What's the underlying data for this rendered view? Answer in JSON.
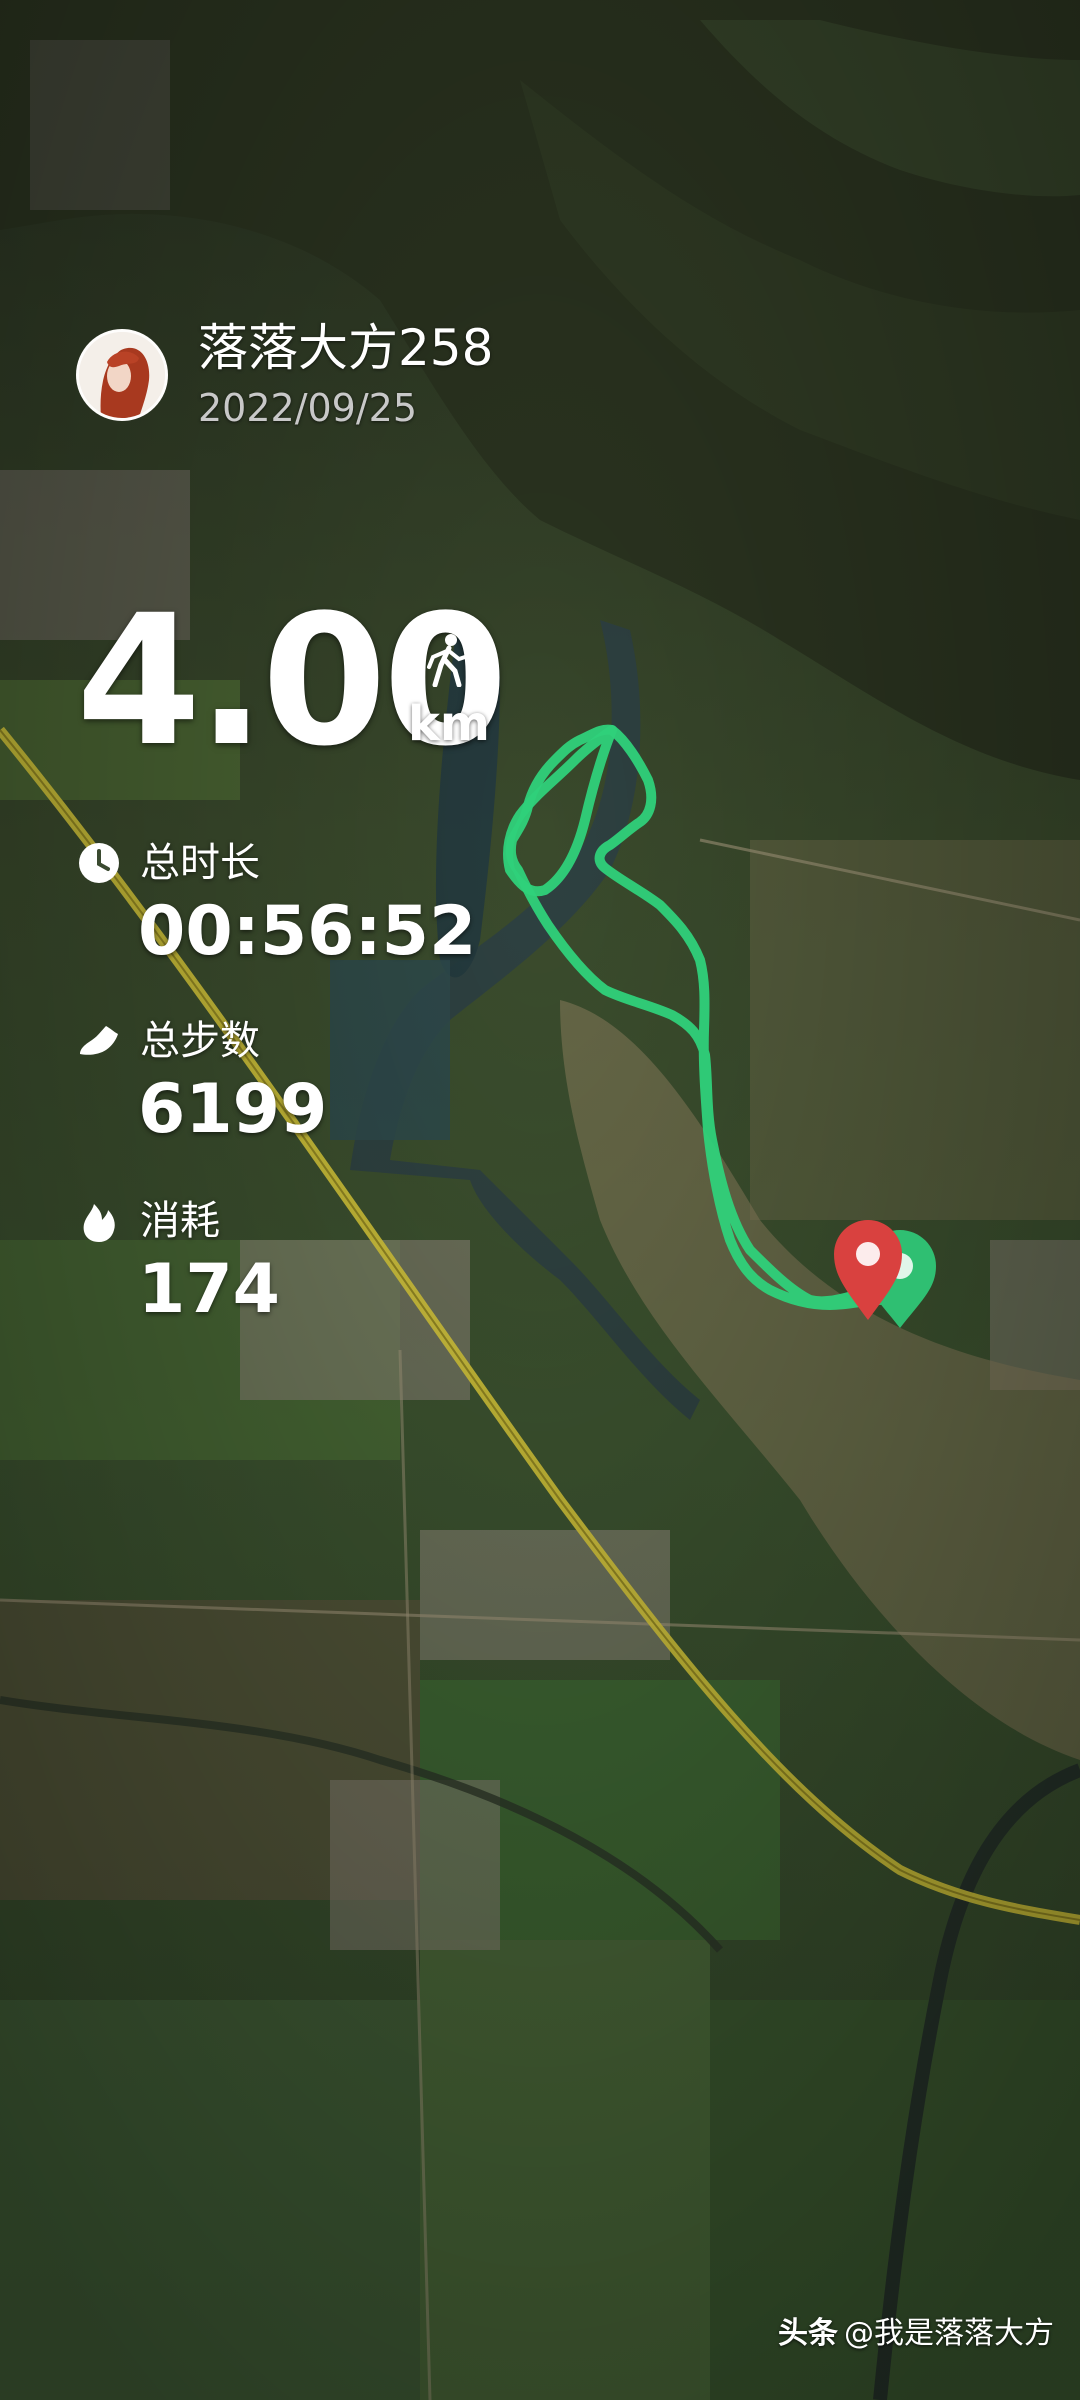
{
  "user": {
    "name": "落落大方258",
    "date": "2022/09/25",
    "avatar_icon": "avatar-photo"
  },
  "activity": {
    "distance": "4.00",
    "unit": "km",
    "type_icon": "walking-person-icon"
  },
  "stats": [
    {
      "label": "总时长",
      "value": "00:56:52",
      "icon": "clock-icon"
    },
    {
      "label": "总步数",
      "value": "6199",
      "icon": "shoe-icon"
    },
    {
      "label": "消耗",
      "value": "174",
      "icon": "flame-icon"
    }
  ],
  "watermark": {
    "brand": "头条",
    "handle": "@我是落落大方"
  },
  "colors": {
    "route": "#2fd17a",
    "start_pin": "#d9413f",
    "end_pin": "#2fbf72",
    "highway": "#d8c93a"
  }
}
